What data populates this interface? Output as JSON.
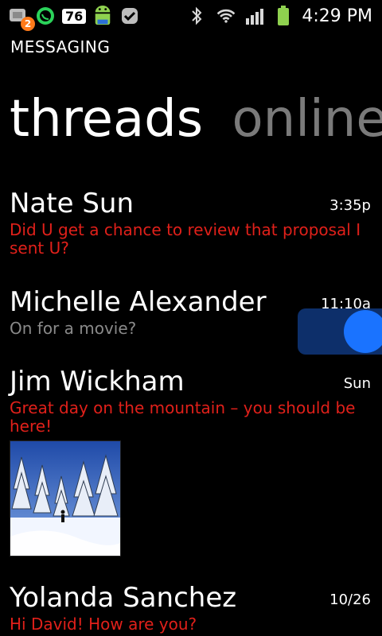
{
  "status_bar": {
    "notification_count": "2",
    "battery_percent": "76",
    "time": "4:29 PM",
    "icons": [
      "gmail-icon",
      "whatsapp-icon",
      "android-icon",
      "check-icon",
      "bluetooth-icon",
      "wifi-icon",
      "signal-icon",
      "battery-icon"
    ]
  },
  "app": {
    "title": "MESSAGING"
  },
  "pivot": {
    "active": "threads",
    "inactive": "online"
  },
  "threads": [
    {
      "name": "Nate Sun",
      "time": "3:35p",
      "snippet": "Did U get a chance to review that proposal I sent U?",
      "unread": true
    },
    {
      "name": "Michelle Alexander",
      "time": "11:10a",
      "snippet": "On for a movie?",
      "unread": false
    },
    {
      "name": "Jim Wickham",
      "time": "Sun",
      "snippet": "Great day on the mountain – you should be here!",
      "unread": true,
      "has_image": true
    },
    {
      "name": "Yolanda Sanchez",
      "time": "10/26",
      "snippet": "Hi David! How are you?",
      "unread": true
    }
  ],
  "colors": {
    "background": "#000000",
    "unread_snippet": "#e0201a",
    "read_snippet": "#8a8a8a",
    "pivot_inactive": "#7a7a7a",
    "toggle_bg": "#0d2f6a",
    "toggle_knob": "#1a73ff"
  }
}
